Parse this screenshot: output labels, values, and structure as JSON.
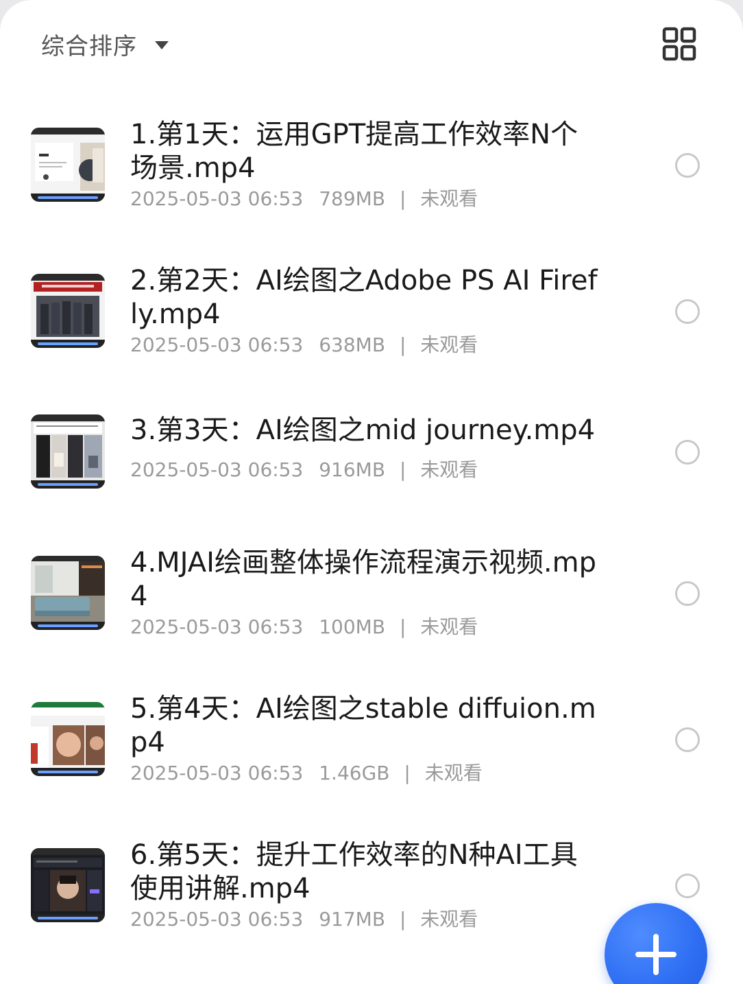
{
  "toolbar": {
    "sort_label": "综合排序",
    "sort_icon": "caret-down-icon",
    "view_toggle_icon": "grid-view-icon"
  },
  "files": [
    {
      "title": "1.第1天：运用GPT提高工作效率N个场景.mp4",
      "date": "2025-05-03 06:53",
      "size": "789MB",
      "status": "未观看",
      "separator": "|"
    },
    {
      "title": "2.第2天：AI绘图之Adobe PS AI Firefly.mp4",
      "date": "2025-05-03 06:53",
      "size": "638MB",
      "status": "未观看",
      "separator": "|"
    },
    {
      "title": "3.第3天：AI绘图之mid journey.mp4",
      "date": "2025-05-03 06:53",
      "size": "916MB",
      "status": "未观看",
      "separator": "|"
    },
    {
      "title": "4.MJAI绘画整体操作流程演示视频.mp4",
      "date": "2025-05-03 06:53",
      "size": "100MB",
      "status": "未观看",
      "separator": "|"
    },
    {
      "title": "5.第4天：AI绘图之stable diffuion.mp4",
      "date": "2025-05-03 06:53",
      "size": "1.46GB",
      "status": "未观看",
      "separator": "|"
    },
    {
      "title": "6.第5天：提升工作效率的N种AI工具使用讲解.mp4",
      "date": "2025-05-03 06:53",
      "size": "917MB",
      "status": "未观看",
      "separator": "|"
    }
  ],
  "fab": {
    "icon": "plus-icon",
    "color": "#2f6ff3"
  }
}
